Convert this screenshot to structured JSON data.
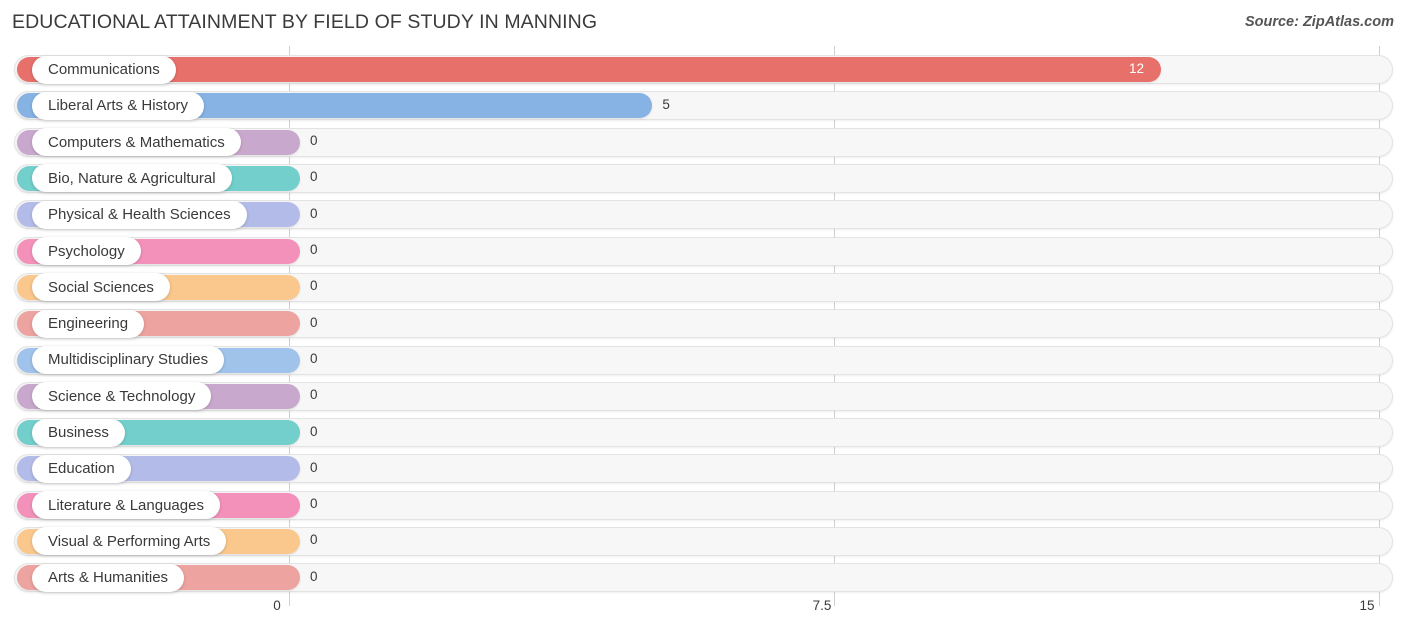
{
  "header": {
    "title": "EDUCATIONAL ATTAINMENT BY FIELD OF STUDY IN MANNING",
    "source": "Source: ZipAtlas.com"
  },
  "axis": {
    "ticks": [
      "0",
      "7.5",
      "15"
    ]
  },
  "chart_data": {
    "type": "bar",
    "orientation": "horizontal",
    "title": "EDUCATIONAL ATTAINMENT BY FIELD OF STUDY IN MANNING",
    "xlabel": "",
    "ylabel": "",
    "xlim": [
      0,
      15
    ],
    "xticks": [
      0,
      7.5,
      15
    ],
    "grid": true,
    "legend": "none",
    "categories": [
      "Communications",
      "Liberal Arts & History",
      "Computers & Mathematics",
      "Bio, Nature & Agricultural",
      "Physical & Health Sciences",
      "Psychology",
      "Social Sciences",
      "Engineering",
      "Multidisciplinary Studies",
      "Science & Technology",
      "Business",
      "Education",
      "Literature & Languages",
      "Visual & Performing Arts",
      "Arts & Humanities"
    ],
    "values": [
      12,
      5,
      0,
      0,
      0,
      0,
      0,
      0,
      0,
      0,
      0,
      0,
      0,
      0,
      0
    ],
    "value_labels": [
      "12",
      "5",
      "0",
      "0",
      "0",
      "0",
      "0",
      "0",
      "0",
      "0",
      "0",
      "0",
      "0",
      "0",
      "0"
    ],
    "colors": [
      "#e8706b",
      "#86b3e4",
      "#c9a8cd",
      "#73cfcb",
      "#b3bce9",
      "#f391ba",
      "#fac78c",
      "#eda39f",
      "#9fc3ea",
      "#c9a8cd",
      "#73cfcb",
      "#b3bce9",
      "#f391ba",
      "#fac78c",
      "#eda39f"
    ]
  },
  "rows": [
    {
      "label": "Communications",
      "value": "12",
      "color": "#e8706b"
    },
    {
      "label": "Liberal Arts & History",
      "value": "5",
      "color": "#86b3e4"
    },
    {
      "label": "Computers & Mathematics",
      "value": "0",
      "color": "#c9a8cd"
    },
    {
      "label": "Bio, Nature & Agricultural",
      "value": "0",
      "color": "#73cfcb"
    },
    {
      "label": "Physical & Health Sciences",
      "value": "0",
      "color": "#b3bce9"
    },
    {
      "label": "Psychology",
      "value": "0",
      "color": "#f391ba"
    },
    {
      "label": "Social Sciences",
      "value": "0",
      "color": "#fac78c"
    },
    {
      "label": "Engineering",
      "value": "0",
      "color": "#eda39f"
    },
    {
      "label": "Multidisciplinary Studies",
      "value": "0",
      "color": "#9fc3ea"
    },
    {
      "label": "Science & Technology",
      "value": "0",
      "color": "#c9a8cd"
    },
    {
      "label": "Business",
      "value": "0",
      "color": "#73cfcb"
    },
    {
      "label": "Education",
      "value": "0",
      "color": "#b3bce9"
    },
    {
      "label": "Literature & Languages",
      "value": "0",
      "color": "#f391ba"
    },
    {
      "label": "Visual & Performing Arts",
      "value": "0",
      "color": "#fac78c"
    },
    {
      "label": "Arts & Humanities",
      "value": "0",
      "color": "#eda39f"
    }
  ]
}
